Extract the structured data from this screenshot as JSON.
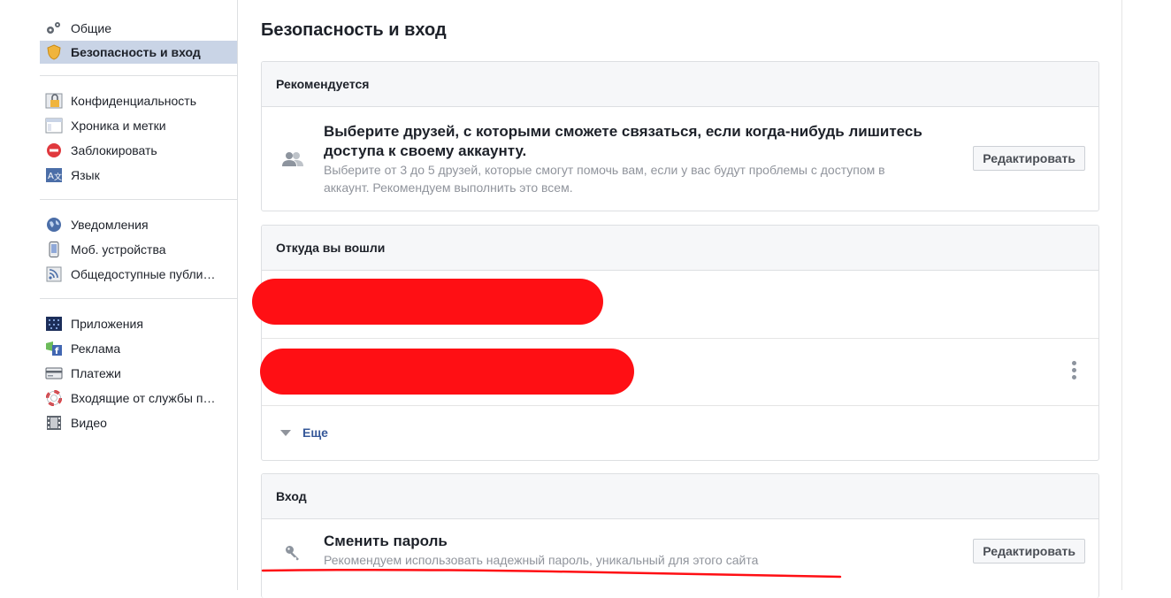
{
  "sidebar": {
    "groups": [
      [
        {
          "label": "Общие",
          "icon": "gears-icon"
        },
        {
          "label": "Безопасность и вход",
          "icon": "shield-icon",
          "active": true
        }
      ],
      [
        {
          "label": "Конфиденциальность",
          "icon": "lock-icon"
        },
        {
          "label": "Хроника и метки",
          "icon": "timeline-icon"
        },
        {
          "label": "Заблокировать",
          "icon": "block-icon"
        },
        {
          "label": "Язык",
          "icon": "language-icon"
        }
      ],
      [
        {
          "label": "Уведомления",
          "icon": "globe-icon"
        },
        {
          "label": "Моб. устройства",
          "icon": "mobile-icon"
        },
        {
          "label": "Общедоступные публи…",
          "icon": "rss-icon"
        }
      ],
      [
        {
          "label": "Приложения",
          "icon": "apps-icon"
        },
        {
          "label": "Реклама",
          "icon": "ads-icon"
        },
        {
          "label": "Платежи",
          "icon": "card-icon"
        },
        {
          "label": "Входящие от службы п…",
          "icon": "lifebuoy-icon"
        },
        {
          "label": "Видео",
          "icon": "film-icon"
        }
      ]
    ]
  },
  "main": {
    "title": "Безопасность и вход",
    "recommended": {
      "header": "Рекомендуется",
      "title": "Выберите друзей, с которыми сможете связаться, если когда-нибудь лишитесь доступа к своему аккаунту.",
      "subtitle": "Выберите от 3 до 5 друзей, которые смогут помочь вам, если у вас будут проблемы с доступом в аккаунт. Рекомендуем выполнить это всем.",
      "button": "Редактировать"
    },
    "where_logged_in": {
      "header": "Откуда вы вошли",
      "more": "Еще"
    },
    "login": {
      "header": "Вход",
      "title": "Сменить пароль",
      "subtitle": "Рекомендуем использовать надежный пароль, уникальный для этого сайта",
      "button": "Редактировать"
    }
  },
  "colors": {
    "active_bg": "#c9d4e6",
    "link": "#365899",
    "redaction": "#ff0f14",
    "panel_head_bg": "#f6f7f9"
  }
}
